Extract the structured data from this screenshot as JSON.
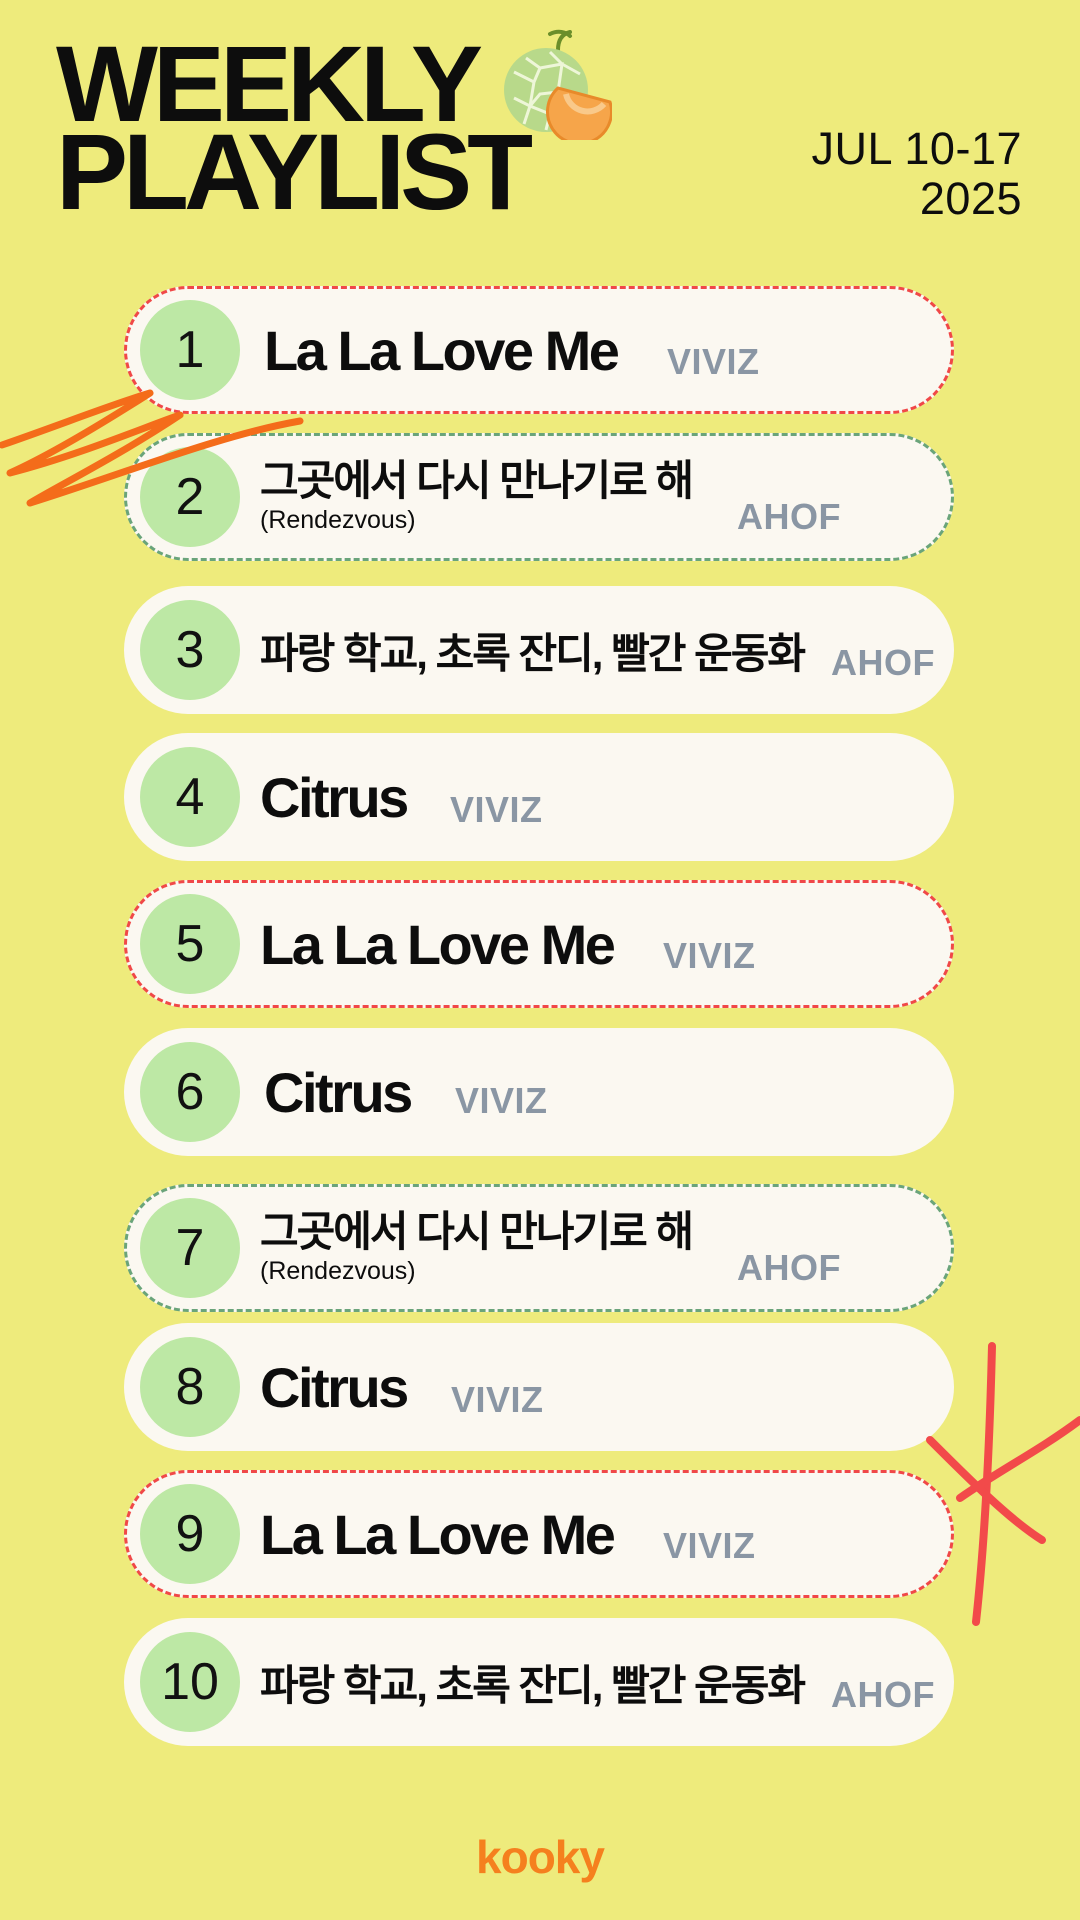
{
  "header": {
    "title_line1": "WEEKLY",
    "title_line2": "PLAYLIST",
    "date_line1": "JUL 10-17",
    "date_line2": "2025",
    "decoration_icon": "melon-icon"
  },
  "tracks": [
    {
      "rank": "1",
      "title": "La La Love Me",
      "subtitle": "",
      "artist": "VIVIZ",
      "border": "red"
    },
    {
      "rank": "2",
      "title": "그곳에서 다시 만나기로 해",
      "subtitle": "(Rendezvous)",
      "artist": "AHOF",
      "border": "green"
    },
    {
      "rank": "3",
      "title": "파랑 학교, 초록 잔디, 빨간 운동화",
      "subtitle": "",
      "artist": "AHOF",
      "border": "none"
    },
    {
      "rank": "4",
      "title": "Citrus",
      "subtitle": "",
      "artist": "VIVIZ",
      "border": "none"
    },
    {
      "rank": "5",
      "title": "La La Love Me",
      "subtitle": "",
      "artist": "VIVIZ",
      "border": "red"
    },
    {
      "rank": "6",
      "title": "Citrus",
      "subtitle": "",
      "artist": "VIVIZ",
      "border": "none"
    },
    {
      "rank": "7",
      "title": "그곳에서 다시 만나기로 해",
      "subtitle": "(Rendezvous)",
      "artist": "AHOF",
      "border": "green"
    },
    {
      "rank": "8",
      "title": "Citrus",
      "subtitle": "",
      "artist": "VIVIZ",
      "border": "none"
    },
    {
      "rank": "9",
      "title": "La La Love Me",
      "subtitle": "",
      "artist": "VIVIZ",
      "border": "red"
    },
    {
      "rank": "10",
      "title": "파랑 학교, 초록 잔디, 빨간 운동화",
      "subtitle": "",
      "artist": "AHOF",
      "border": "none"
    }
  ],
  "footer": {
    "brand": "kooky"
  },
  "colors": {
    "background": "#eeeb7c",
    "card": "#fbf8f1",
    "rank_circle": "#bde8a5",
    "dash_red": "#f04848",
    "dash_green": "#6aa47a",
    "artist_text": "#8a96a4",
    "brand_orange": "#f5801e"
  }
}
